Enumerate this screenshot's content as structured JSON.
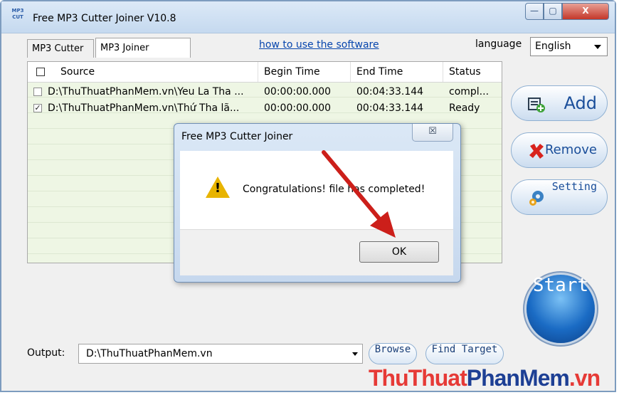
{
  "window": {
    "title": "Free MP3 Cutter Joiner V10.8",
    "app_icon_top": "MP3",
    "app_icon_bottom": "CUT",
    "minimize_glyph": "—",
    "maximize_glyph": "▢",
    "close_glyph": "X"
  },
  "tabs": [
    {
      "label": "MP3 Cutter",
      "active": false
    },
    {
      "label": "MP3 Joiner",
      "active": true
    }
  ],
  "help_link": "how to use the software",
  "language": {
    "label": "language",
    "selected": "English"
  },
  "file_list": {
    "columns": [
      "Source",
      "Begin Time",
      "End Time",
      "Status"
    ],
    "rows": [
      {
        "checked": false,
        "source": "D:\\ThuThuatPhanMem.vn\\Yeu La Tha ...",
        "begin": "00:00:00.000",
        "end": "00:04:33.144",
        "status": "compl..."
      },
      {
        "checked": true,
        "source": "D:\\ThuThuatPhanMem.vn\\Thứ Tha lã...",
        "begin": "00:00:00.000",
        "end": "00:04:33.144",
        "status": "Ready"
      }
    ]
  },
  "side_buttons": {
    "add": "Add",
    "remove": "Remove",
    "setting": "Setting",
    "start": "Start"
  },
  "output": {
    "label": "Output:",
    "path": "D:\\ThuThuatPhanMem.vn",
    "browse": "Browse",
    "find_target": "Find Target"
  },
  "dialog": {
    "title": "Free MP3 Cutter Joiner",
    "close_glyph": "☒",
    "message": "Congratulations! file has completed!",
    "ok": "OK"
  },
  "watermark": {
    "part1": "ThuThuat",
    "part2": "PhanMem",
    "part3": ".vn"
  },
  "colors": {
    "arrow": "#cc1f1a",
    "accent": "#1a4e9a"
  }
}
